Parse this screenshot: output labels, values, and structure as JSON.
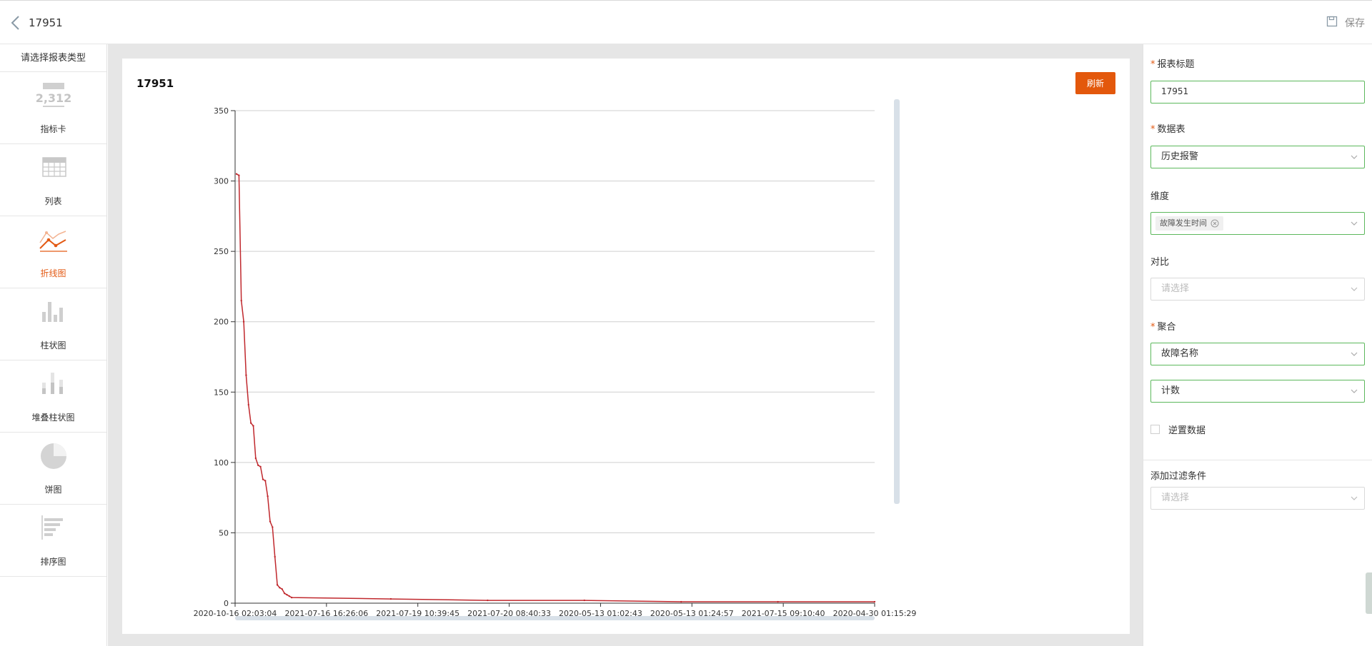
{
  "header": {
    "title": "17951",
    "save_label": "保存"
  },
  "sidebar": {
    "title": "请选择报表类型",
    "items": [
      {
        "label": "指标卡",
        "icon": "metric-card-icon",
        "icon_text": "2,312"
      },
      {
        "label": "列表",
        "icon": "table-icon"
      },
      {
        "label": "折线图",
        "icon": "line-chart-icon",
        "active": true
      },
      {
        "label": "柱状图",
        "icon": "bar-chart-icon"
      },
      {
        "label": "堆叠柱状图",
        "icon": "stacked-bar-chart-icon"
      },
      {
        "label": "饼图",
        "icon": "pie-chart-icon"
      },
      {
        "label": "排序图",
        "icon": "sorted-bar-icon"
      }
    ]
  },
  "card": {
    "title": "17951",
    "refresh_label": "刷新"
  },
  "chart_data": {
    "type": "line",
    "ylim": [
      0,
      350
    ],
    "yticks": [
      0,
      50,
      100,
      150,
      200,
      250,
      300,
      350
    ],
    "x_tick_labels": [
      "2020-10-16 02:03:04",
      "2021-07-16 16:26:06",
      "2021-07-19 10:39:45",
      "2021-07-20 08:40:33",
      "2020-05-13 01:02:43",
      "2020-05-13 01:24:57",
      "2021-07-15 09:10:40",
      "2020-04-30 01:15:29"
    ],
    "grid": true,
    "series": [
      {
        "color": "#c0282d",
        "values": [
          305,
          304,
          215,
          200,
          162,
          141,
          128,
          126,
          103,
          98,
          97,
          88,
          87,
          76,
          58,
          54,
          33,
          13,
          11,
          10,
          7,
          6,
          5,
          4,
          3,
          2,
          2,
          1,
          1,
          1
        ]
      }
    ]
  },
  "panel": {
    "title_label": "报表标题",
    "title_value": "17951",
    "table_label": "数据表",
    "table_value": "历史报警",
    "dimension_label": "维度",
    "dimension_tag": "故障发生时间",
    "compare_label": "对比",
    "compare_placeholder": "请选择",
    "aggregate_label": "聚合",
    "aggregate_field": "故障名称",
    "aggregate_method": "计数",
    "transpose_label": "逆置数据",
    "filter_label": "添加过滤条件",
    "filter_placeholder": "请选择"
  },
  "colors": {
    "accent": "#e3580c",
    "line": "#c0282d",
    "valid_border": "#5cb85c"
  }
}
